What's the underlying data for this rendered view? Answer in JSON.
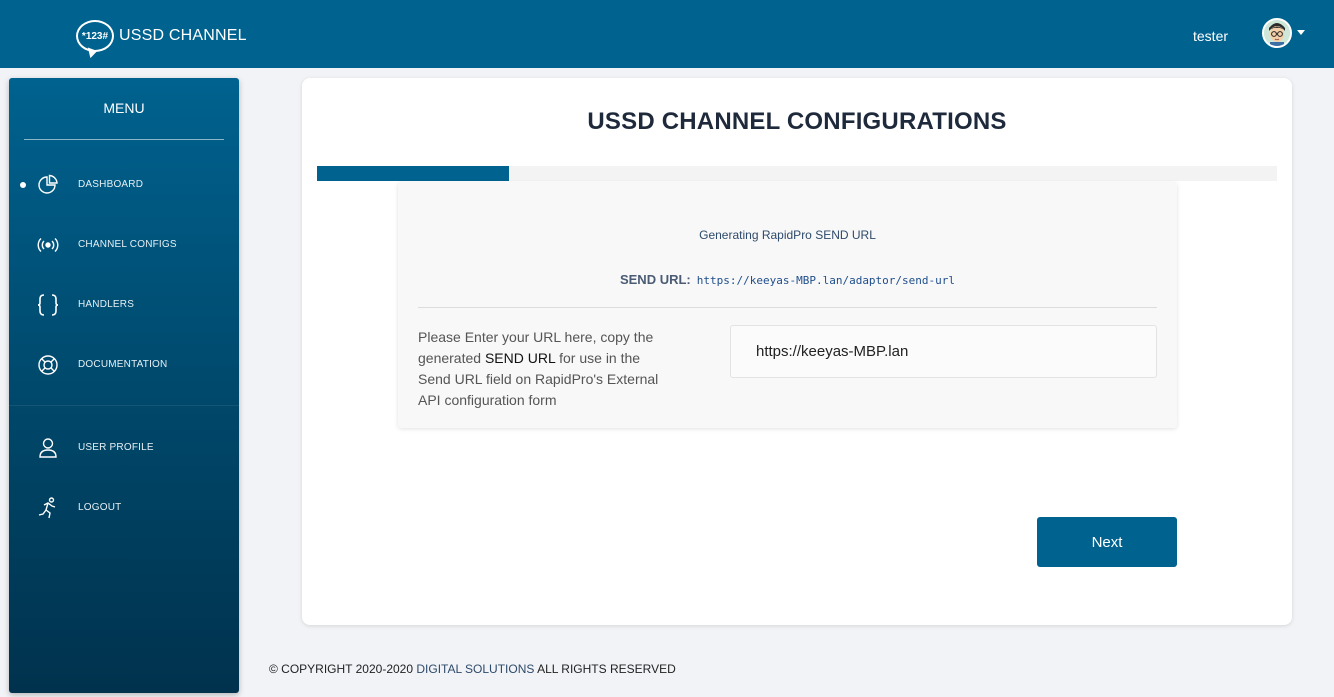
{
  "header": {
    "logo_badge": "*123#",
    "logo_text": "USSD CHANNEL",
    "user_name": "tester"
  },
  "sidebar": {
    "menu_title": "MENU",
    "items": [
      {
        "label": "DASHBOARD",
        "icon": "pie-chart-icon",
        "active": true
      },
      {
        "label": "CHANNEL CONFIGS",
        "icon": "broadcast-icon",
        "active": false
      },
      {
        "label": "HANDLERS",
        "icon": "curly-braces-icon",
        "active": false
      },
      {
        "label": "DOCUMENTATION",
        "icon": "lifebuoy-icon",
        "active": false
      },
      {
        "label": "USER PROFILE",
        "icon": "user-icon",
        "active": false
      },
      {
        "label": "LOGOUT",
        "icon": "running-person-icon",
        "active": false
      }
    ]
  },
  "main": {
    "title": "USSD CHANNEL CONFIGURATIONS",
    "progress_fraction": 0.2,
    "generating_text": "Generating RapidPro SEND URL",
    "send_url_label": "SEND URL:",
    "send_url_value": "https://keeyas-MBP.lan/adaptor/send-url",
    "help_text_before": "Please Enter your URL here, copy the generated ",
    "help_text_emphasis": "SEND URL",
    "help_text_after": " for use in the Send URL field on RapidPro's External API configuration form",
    "url_input_value": "https://keeyas-MBP.lan",
    "next_label": "Next"
  },
  "footer": {
    "prefix": "© COPYRIGHT 2020-2020 ",
    "org": "DIGITAL SOLUTIONS",
    "suffix": " ALL RIGHTS RESERVED"
  },
  "colors": {
    "primary": "#00628f",
    "background": "#f1f3f6",
    "title": "#1e2a3c"
  }
}
